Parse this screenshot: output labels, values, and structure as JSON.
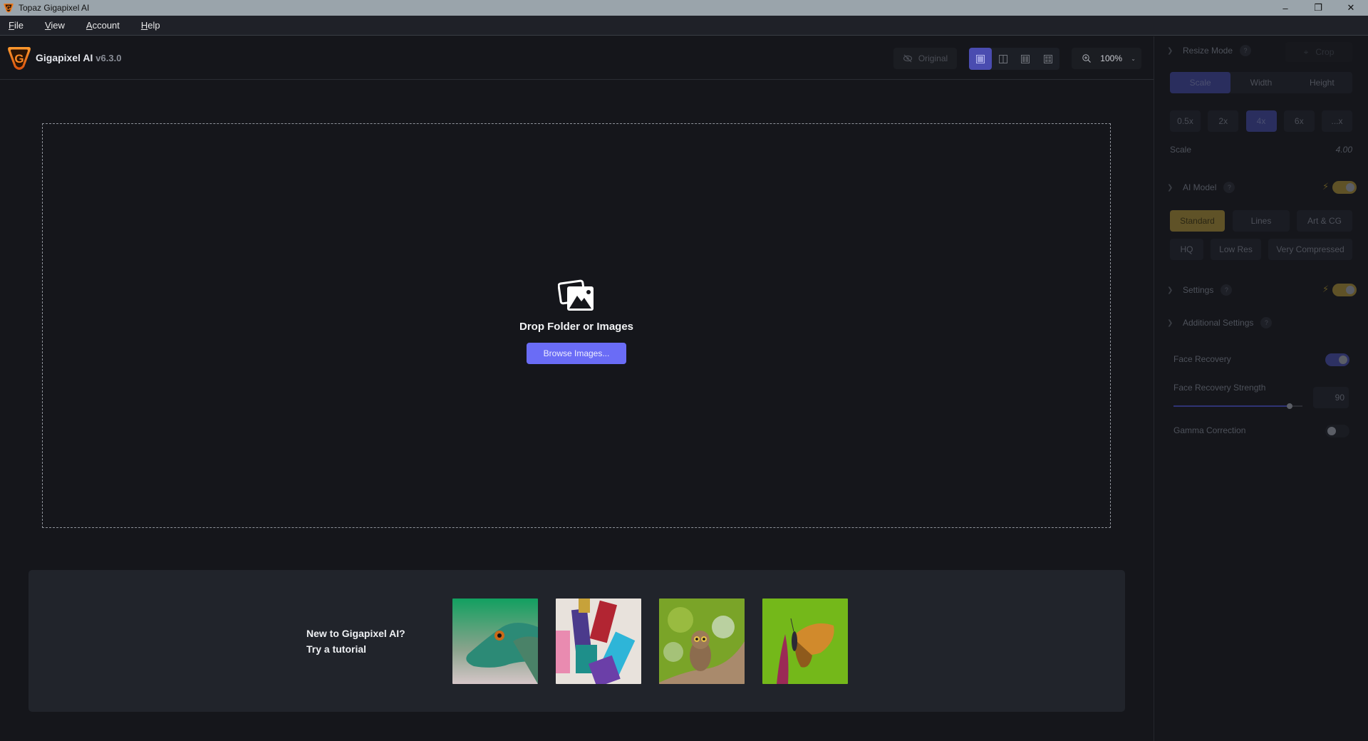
{
  "window": {
    "title": "Topaz Gigapixel AI",
    "controls": {
      "minimize": "–",
      "maximize": "❐",
      "close": "✕"
    }
  },
  "menu": [
    {
      "label": "File",
      "mnemonic": "F",
      "rest": "ile"
    },
    {
      "label": "View",
      "mnemonic": "V",
      "rest": "iew"
    },
    {
      "label": "Account",
      "mnemonic": "A",
      "rest": "ccount"
    },
    {
      "label": "Help",
      "mnemonic": "H",
      "rest": "elp"
    }
  ],
  "header": {
    "app_name": "Gigapixel AI",
    "version": "v6.3.0",
    "original_label": "Original",
    "view_modes": [
      "single-view",
      "split-view",
      "side-by-side-view",
      "grid-view"
    ],
    "active_view": "single-view",
    "zoom_level": "100%"
  },
  "dropzone": {
    "title": "Drop Folder or Images",
    "browse_label": "Browse Images..."
  },
  "tutorial": {
    "line1": "New to Gigapixel AI?",
    "line2": "Try a tutorial",
    "thumbnails": [
      "lizard",
      "paint-brushes",
      "owl",
      "butterfly"
    ]
  },
  "sidebar": {
    "resize_mode": {
      "title": "Resize Mode",
      "help": "?",
      "crop_label": "Crop",
      "tabs": [
        "Scale",
        "Width",
        "Height"
      ],
      "active_tab": "Scale",
      "presets": [
        "0.5x",
        "2x",
        "4x",
        "6x",
        "...x"
      ],
      "active_preset": "4x",
      "scale_label": "Scale",
      "scale_value": "4.00"
    },
    "ai_model": {
      "title": "AI Model",
      "help": "?",
      "enabled": true,
      "models_row1": [
        "Standard",
        "Lines",
        "Art & CG"
      ],
      "models_row2": [
        "HQ",
        "Low Res",
        "Very Compressed"
      ],
      "active_model": "Standard"
    },
    "settings": {
      "title": "Settings",
      "help": "?",
      "enabled": true
    },
    "additional_settings": {
      "title": "Additional Settings",
      "help": "?",
      "face_recovery_label": "Face Recovery",
      "face_recovery_enabled": true,
      "face_recovery_strength_label": "Face Recovery Strength",
      "face_recovery_strength": "90",
      "face_recovery_strength_fraction": 0.9,
      "gamma_correction_label": "Gamma Correction",
      "gamma_correction_enabled": false
    }
  },
  "colors": {
    "accent": "#6a6cf6",
    "active_blue": "#2a2e5e",
    "gold": "#5f5227",
    "background": "#15161b",
    "panel": "#21242b",
    "brand_orange": "#f07a1a"
  }
}
